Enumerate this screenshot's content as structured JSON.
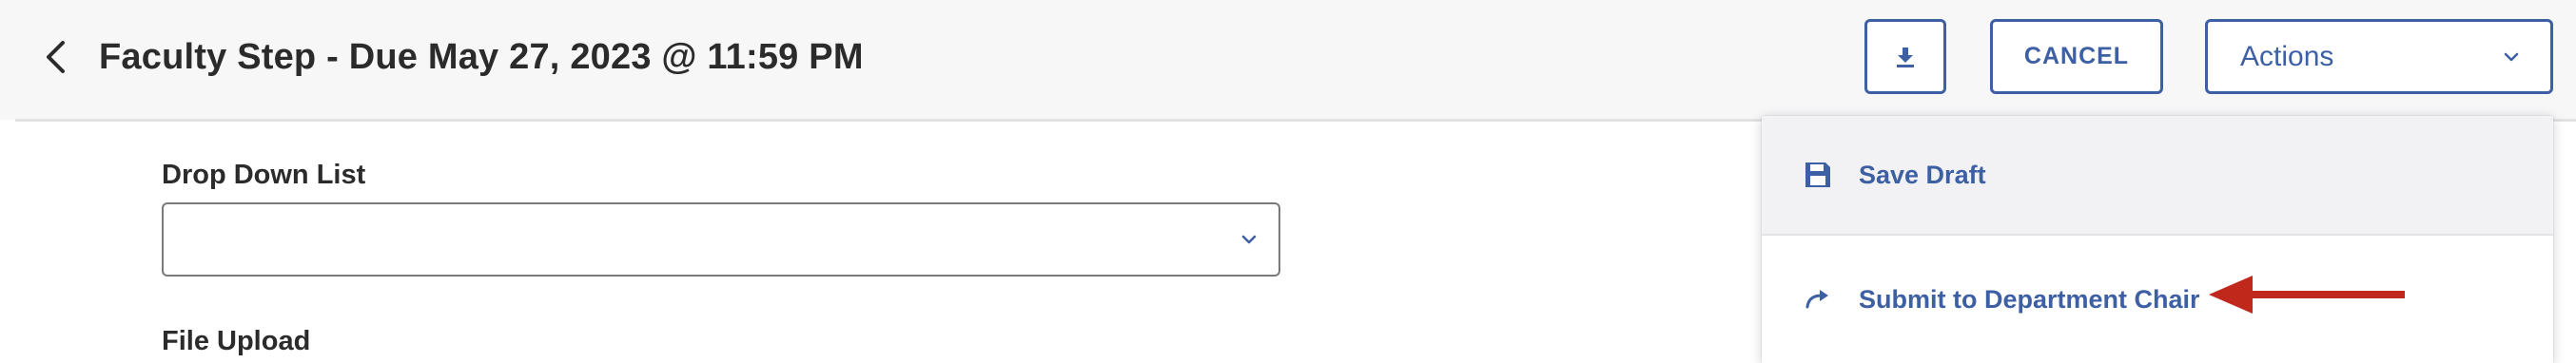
{
  "header": {
    "title": "Faculty Step - Due May 27, 2023 @ 11:59 PM",
    "cancel_label": "CANCEL",
    "actions_label": "Actions"
  },
  "form": {
    "dropdown_label": "Drop Down List",
    "dropdown_value": "",
    "upload_label": "File Upload"
  },
  "actions_menu": {
    "items": [
      {
        "label": "Save Draft",
        "icon": "save-icon"
      },
      {
        "label": "Submit to Department Chair",
        "icon": "redo-arrow-icon"
      }
    ]
  },
  "annotation": {
    "icon": "red-arrow-pointer"
  },
  "colors": {
    "accent": "#3d5fa3",
    "header_bg": "#f7f7f8",
    "annotation_red": "#c0281b"
  }
}
